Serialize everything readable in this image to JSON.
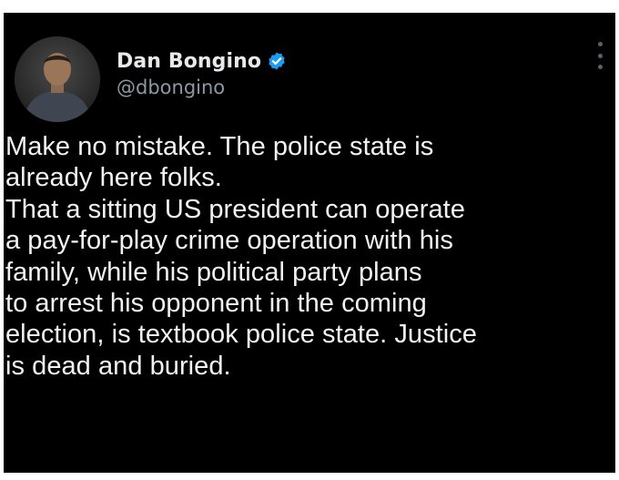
{
  "author": {
    "name": "Dan Bongino",
    "handle": "@dbongino"
  },
  "icons": {
    "verified": "verified-badge-icon",
    "more": "more-options-icon"
  },
  "colors": {
    "background": "#000000",
    "name_text": "#e7e9ea",
    "handle_text": "#8b98a5",
    "body_text": "#f2f2f2",
    "verified_blue": "#1d9bf0"
  },
  "tweet": {
    "lines": [
      "Make no mistake. The police state is",
      "already here folks.",
      "That a sitting US president can operate",
      "a pay-for-play crime operation with his",
      "family, while his political party plans",
      "to arrest his opponent in the coming",
      "election, is textbook police state. Justice",
      "is dead and buried."
    ]
  }
}
